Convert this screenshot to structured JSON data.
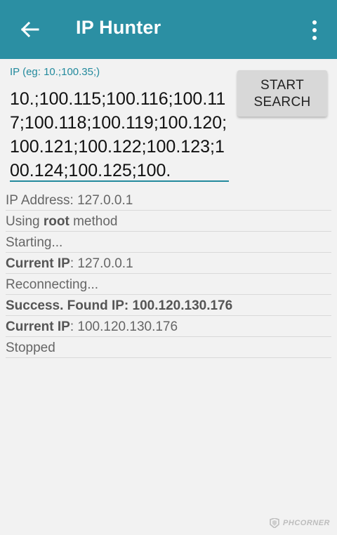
{
  "app_bar": {
    "title": "IP Hunter",
    "back_icon": "arrow-left-icon",
    "menu_icon": "more-vert-icon",
    "color": "#2b8fa3"
  },
  "ip_field": {
    "label": "IP (eg: 10.;100.35;)",
    "value": "10.;100.115;100.116;100.117;100.118;100.119;100.120;100.121;100.122;100.123;100.124;100.125;100.",
    "accent_color": "#238a9d"
  },
  "start_button": {
    "line1": "START",
    "line2": "SEARCH"
  },
  "log": [
    {
      "bold": "",
      "text": "IP Address: 127.0.0.1"
    },
    {
      "prefix": "Using ",
      "bold": "root",
      "text": " method"
    },
    {
      "bold": "",
      "text": "Starting..."
    },
    {
      "bold": "Current IP",
      "text": ": 127.0.0.1"
    },
    {
      "bold": "",
      "text": "Reconnecting..."
    },
    {
      "bold": "Success. Found IP: 100.120.130.176",
      "text": ""
    },
    {
      "bold": "Current IP",
      "text": ": 100.120.130.176"
    },
    {
      "bold": "",
      "text": "Stopped"
    }
  ],
  "watermark": {
    "text": "PHCORNER",
    "icon": "phcorner-logo-icon"
  }
}
